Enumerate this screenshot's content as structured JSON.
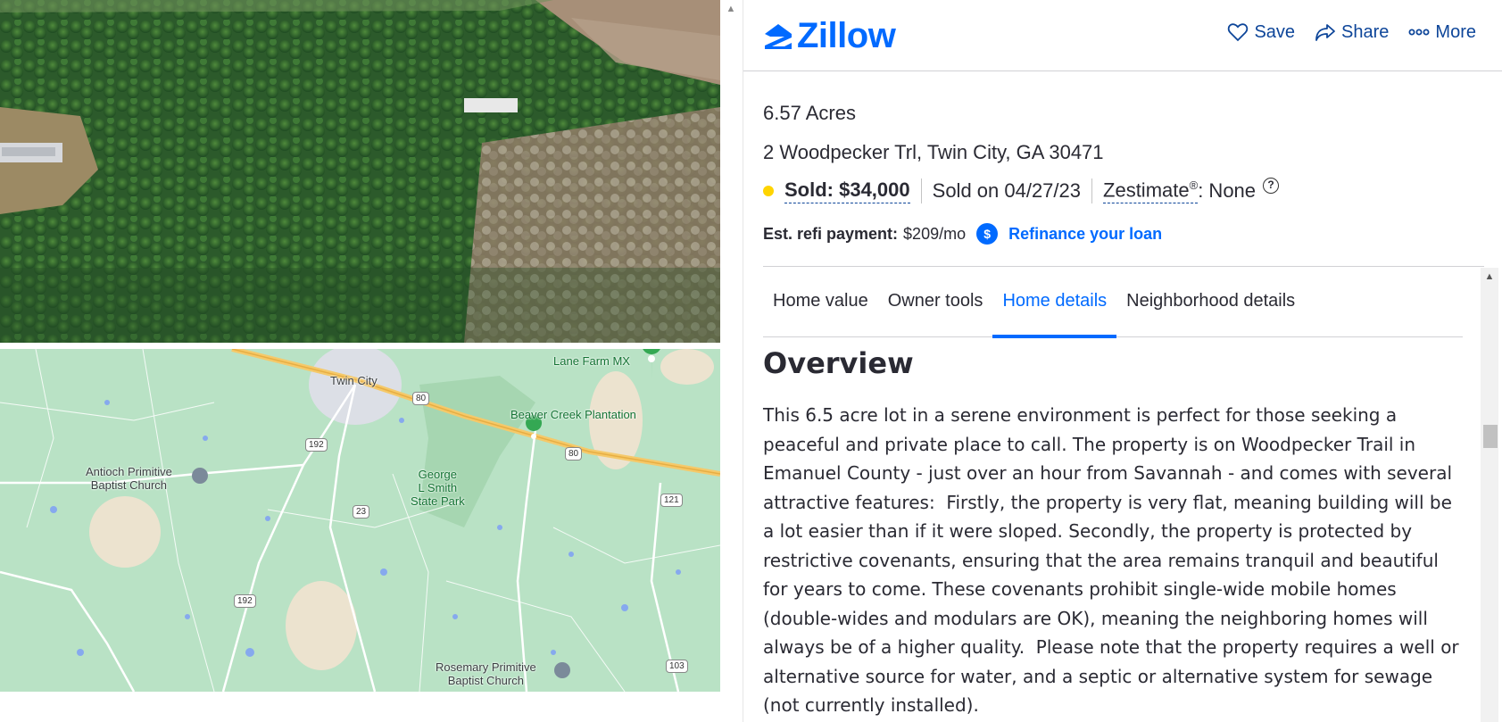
{
  "header": {
    "logo_text": "Zillow",
    "actions": [
      {
        "label": "Save",
        "icon": "heart-icon"
      },
      {
        "label": "Share",
        "icon": "share-arrow-icon"
      },
      {
        "label": "More",
        "icon": "more-dots-icon"
      }
    ]
  },
  "listing": {
    "acres": "6.57 Acres",
    "address": "2 Woodpecker Trl, Twin City, GA 30471",
    "sold_label": "Sold: $34,000",
    "sold_on": "Sold on 04/27/23",
    "zestimate_label": "Zestimate",
    "zestimate_sup": "®",
    "zestimate_value": ": None",
    "help": "?",
    "status_color": "#ffd400",
    "refi_label": "Est. refi payment:",
    "refi_value": "$209/mo",
    "refi_icon_glyph": "$",
    "refi_link": "Refinance your loan"
  },
  "tabs": [
    {
      "label": "Home value",
      "active": false
    },
    {
      "label": "Owner tools",
      "active": false
    },
    {
      "label": "Home details",
      "active": true
    },
    {
      "label": "Neighborhood details",
      "active": false
    }
  ],
  "overview": {
    "title": "Overview",
    "text": "This 6.5 acre lot in a serene environment is perfect for those seeking a peaceful and private place to call. The property is on Woodpecker Trail in Emanuel County - just over an hour from Savannah - and comes with several attractive features:  Firstly, the property is very flat, meaning building will be a lot easier than if it were sloped. Secondly, the property is protected by restrictive covenants, ensuring that the area remains tranquil and beautiful for years to come. These covenants prohibit single-wide mobile homes (double-wides and modulars are OK), meaning the neighboring homes will always be of a higher quality.  Please note that the property requires a well or alternative source for water, and a septic or alternative system for sewage (not currently installed)."
  },
  "map": {
    "labels": {
      "twin_city": "Twin City",
      "lane_farm": "Lane Farm MX",
      "beaver_creek": "Beaver Creek Plantation",
      "antioch": "Antioch Primitive\nBaptist Church",
      "george_smith": "George\nL Smith\nState Park",
      "rosemary": "Rosemary Primitive\nBaptist Church"
    },
    "shields": [
      "80",
      "192",
      "80",
      "23",
      "121",
      "192",
      "103"
    ]
  },
  "colors": {
    "brand": "#006aff",
    "link_dark": "#0d4599",
    "text": "#2a2a33"
  }
}
